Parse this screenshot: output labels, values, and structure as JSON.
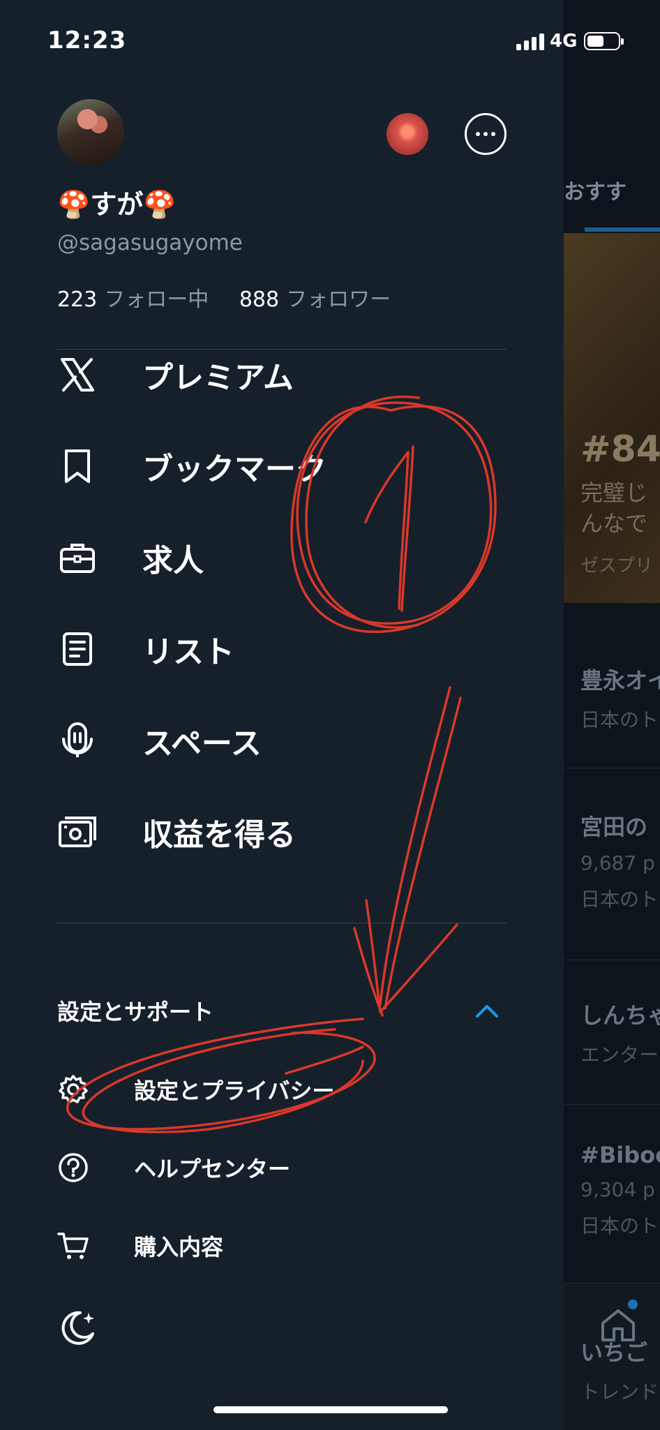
{
  "status_bar": {
    "time": "12:23",
    "network": "4G",
    "battery_level": 0.55,
    "signal_bars": 4
  },
  "profile": {
    "display_name": "🍄すが🍄",
    "handle": "@sagasugayome",
    "following_count": "223",
    "following_label": "フォロー中",
    "followers_count": "888",
    "followers_label": "フォロワー"
  },
  "menu": {
    "items": [
      {
        "label": "プレミアム",
        "icon": "x-logo-icon"
      },
      {
        "label": "ブックマーク",
        "icon": "bookmark-icon"
      },
      {
        "label": "求人",
        "icon": "briefcase-icon"
      },
      {
        "label": "リスト",
        "icon": "list-icon"
      },
      {
        "label": "スペース",
        "icon": "spaces-mic-icon"
      },
      {
        "label": "収益を得る",
        "icon": "money-icon"
      }
    ]
  },
  "settings_section": {
    "title": "設定とサポート",
    "expanded": true,
    "items": [
      {
        "label": "設定とプライバシー",
        "icon": "gear-icon"
      },
      {
        "label": "ヘルプセンター",
        "icon": "help-icon"
      },
      {
        "label": "購入内容",
        "icon": "cart-icon"
      }
    ]
  },
  "theme_toggle": {
    "icon": "moon-icon"
  },
  "background_feed": {
    "tab_label": "おすす",
    "hero": {
      "title": "#84",
      "desc_line1": "完璧じ",
      "desc_line2": "んなで",
      "source": "ゼスプリ"
    },
    "trends": [
      {
        "title": "豊永オイ",
        "sub": "日本のト"
      },
      {
        "title": "宮田の",
        "sub": "9,687 p",
        "sub2": "日本のト"
      },
      {
        "title": "しんちゃ",
        "sub": "エンター"
      },
      {
        "title": "#Biboo",
        "sub": "9,304 p",
        "sub2": "日本のト"
      },
      {
        "title": "いちご",
        "sub": "トレンド"
      }
    ]
  },
  "annotation": {
    "number": "1",
    "color": "#d9382a"
  }
}
